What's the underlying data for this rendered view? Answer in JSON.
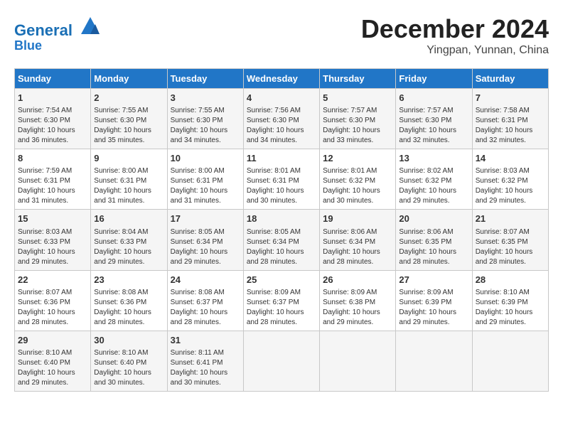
{
  "header": {
    "logo_line1": "General",
    "logo_line2": "Blue",
    "month": "December 2024",
    "location": "Yingpan, Yunnan, China"
  },
  "weekdays": [
    "Sunday",
    "Monday",
    "Tuesday",
    "Wednesday",
    "Thursday",
    "Friday",
    "Saturday"
  ],
  "weeks": [
    [
      {
        "day": "1",
        "info": "Sunrise: 7:54 AM\nSunset: 6:30 PM\nDaylight: 10 hours\nand 36 minutes."
      },
      {
        "day": "2",
        "info": "Sunrise: 7:55 AM\nSunset: 6:30 PM\nDaylight: 10 hours\nand 35 minutes."
      },
      {
        "day": "3",
        "info": "Sunrise: 7:55 AM\nSunset: 6:30 PM\nDaylight: 10 hours\nand 34 minutes."
      },
      {
        "day": "4",
        "info": "Sunrise: 7:56 AM\nSunset: 6:30 PM\nDaylight: 10 hours\nand 34 minutes."
      },
      {
        "day": "5",
        "info": "Sunrise: 7:57 AM\nSunset: 6:30 PM\nDaylight: 10 hours\nand 33 minutes."
      },
      {
        "day": "6",
        "info": "Sunrise: 7:57 AM\nSunset: 6:30 PM\nDaylight: 10 hours\nand 32 minutes."
      },
      {
        "day": "7",
        "info": "Sunrise: 7:58 AM\nSunset: 6:31 PM\nDaylight: 10 hours\nand 32 minutes."
      }
    ],
    [
      {
        "day": "8",
        "info": "Sunrise: 7:59 AM\nSunset: 6:31 PM\nDaylight: 10 hours\nand 31 minutes."
      },
      {
        "day": "9",
        "info": "Sunrise: 8:00 AM\nSunset: 6:31 PM\nDaylight: 10 hours\nand 31 minutes."
      },
      {
        "day": "10",
        "info": "Sunrise: 8:00 AM\nSunset: 6:31 PM\nDaylight: 10 hours\nand 31 minutes."
      },
      {
        "day": "11",
        "info": "Sunrise: 8:01 AM\nSunset: 6:31 PM\nDaylight: 10 hours\nand 30 minutes."
      },
      {
        "day": "12",
        "info": "Sunrise: 8:01 AM\nSunset: 6:32 PM\nDaylight: 10 hours\nand 30 minutes."
      },
      {
        "day": "13",
        "info": "Sunrise: 8:02 AM\nSunset: 6:32 PM\nDaylight: 10 hours\nand 29 minutes."
      },
      {
        "day": "14",
        "info": "Sunrise: 8:03 AM\nSunset: 6:32 PM\nDaylight: 10 hours\nand 29 minutes."
      }
    ],
    [
      {
        "day": "15",
        "info": "Sunrise: 8:03 AM\nSunset: 6:33 PM\nDaylight: 10 hours\nand 29 minutes."
      },
      {
        "day": "16",
        "info": "Sunrise: 8:04 AM\nSunset: 6:33 PM\nDaylight: 10 hours\nand 29 minutes."
      },
      {
        "day": "17",
        "info": "Sunrise: 8:05 AM\nSunset: 6:34 PM\nDaylight: 10 hours\nand 29 minutes."
      },
      {
        "day": "18",
        "info": "Sunrise: 8:05 AM\nSunset: 6:34 PM\nDaylight: 10 hours\nand 28 minutes."
      },
      {
        "day": "19",
        "info": "Sunrise: 8:06 AM\nSunset: 6:34 PM\nDaylight: 10 hours\nand 28 minutes."
      },
      {
        "day": "20",
        "info": "Sunrise: 8:06 AM\nSunset: 6:35 PM\nDaylight: 10 hours\nand 28 minutes."
      },
      {
        "day": "21",
        "info": "Sunrise: 8:07 AM\nSunset: 6:35 PM\nDaylight: 10 hours\nand 28 minutes."
      }
    ],
    [
      {
        "day": "22",
        "info": "Sunrise: 8:07 AM\nSunset: 6:36 PM\nDaylight: 10 hours\nand 28 minutes."
      },
      {
        "day": "23",
        "info": "Sunrise: 8:08 AM\nSunset: 6:36 PM\nDaylight: 10 hours\nand 28 minutes."
      },
      {
        "day": "24",
        "info": "Sunrise: 8:08 AM\nSunset: 6:37 PM\nDaylight: 10 hours\nand 28 minutes."
      },
      {
        "day": "25",
        "info": "Sunrise: 8:09 AM\nSunset: 6:37 PM\nDaylight: 10 hours\nand 28 minutes."
      },
      {
        "day": "26",
        "info": "Sunrise: 8:09 AM\nSunset: 6:38 PM\nDaylight: 10 hours\nand 29 minutes."
      },
      {
        "day": "27",
        "info": "Sunrise: 8:09 AM\nSunset: 6:39 PM\nDaylight: 10 hours\nand 29 minutes."
      },
      {
        "day": "28",
        "info": "Sunrise: 8:10 AM\nSunset: 6:39 PM\nDaylight: 10 hours\nand 29 minutes."
      }
    ],
    [
      {
        "day": "29",
        "info": "Sunrise: 8:10 AM\nSunset: 6:40 PM\nDaylight: 10 hours\nand 29 minutes."
      },
      {
        "day": "30",
        "info": "Sunrise: 8:10 AM\nSunset: 6:40 PM\nDaylight: 10 hours\nand 30 minutes."
      },
      {
        "day": "31",
        "info": "Sunrise: 8:11 AM\nSunset: 6:41 PM\nDaylight: 10 hours\nand 30 minutes."
      },
      {
        "day": "",
        "info": ""
      },
      {
        "day": "",
        "info": ""
      },
      {
        "day": "",
        "info": ""
      },
      {
        "day": "",
        "info": ""
      }
    ]
  ]
}
